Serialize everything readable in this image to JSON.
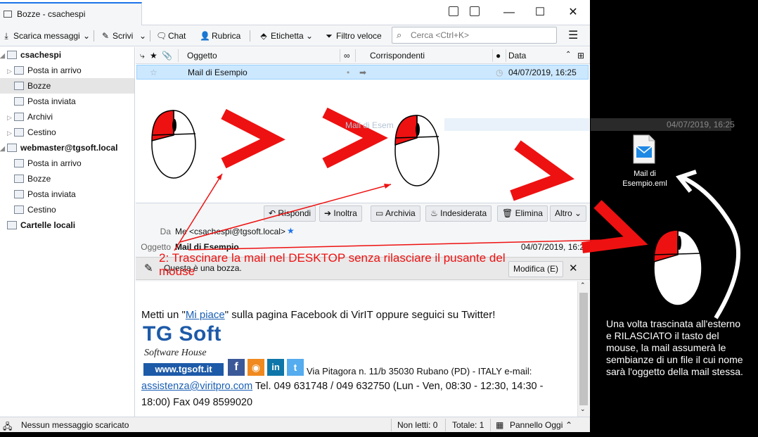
{
  "window": {
    "tab_title": "Bozze - csachespi",
    "minimize": "—",
    "maximize": "☐",
    "close": "✕"
  },
  "toolbar": {
    "get_messages": "Scarica messaggi",
    "write": "Scrivi",
    "chat": "Chat",
    "address_book": "Rubrica",
    "tag": "Etichetta",
    "quick_filter": "Filtro veloce",
    "search_placeholder": "Cerca <Ctrl+K>",
    "menu": "☰"
  },
  "folders": [
    {
      "label": "csachespi",
      "type": "account"
    },
    {
      "label": "Posta in arrivo",
      "type": "folder"
    },
    {
      "label": "Bozze",
      "type": "folder",
      "selected": true
    },
    {
      "label": "Posta inviata",
      "type": "folder"
    },
    {
      "label": "Archivi",
      "type": "folder"
    },
    {
      "label": "Cestino",
      "type": "folder"
    },
    {
      "label": "webmaster@tgsoft.local",
      "type": "account"
    },
    {
      "label": "Posta in arrivo",
      "type": "folder"
    },
    {
      "label": "Bozze",
      "type": "folder"
    },
    {
      "label": "Posta inviata",
      "type": "folder"
    },
    {
      "label": "Cestino",
      "type": "folder"
    },
    {
      "label": "Cartelle locali",
      "type": "account"
    }
  ],
  "list": {
    "col_subject": "Oggetto",
    "col_correspondents": "Corrispondenti",
    "col_date": "Data",
    "row": {
      "subject": "Mail di Esempio",
      "date": "04/07/2019, 16:25"
    }
  },
  "header": {
    "reply": "Rispondi",
    "forward": "Inoltra",
    "archive": "Archivia",
    "junk": "Indesiderata",
    "delete": "Elimina",
    "more": "Altro",
    "from_label": "Da",
    "from_value": "Me <csachespi@tgsoft.local>",
    "subject_label": "Oggetto",
    "subject_value": "Mail di Esempio",
    "date_value": "04/07/2019, 16:25",
    "draft_notice": "Questa è una bozza.",
    "edit_button": "Modifica (E)"
  },
  "body": {
    "line1_pre": "Metti un \"",
    "line1_link": "Mi piace",
    "line1_post": "\" sulla pagina Facebook di VirIT oppure seguici su Twitter!",
    "logo_top": "TG Soft",
    "logo_mid": "Software House",
    "logo_url": "www.tgsoft.it",
    "address": "Via Pitagora n. 11/b 35030 Rubano (PD) - ITALY e-mail:",
    "email_link": "assistenza@viritpro.com",
    "phones": " Tel. 049 631748 / 049 632750 (Lun - Ven, 08:30 - 12:30, 14:30 -",
    "phones2": "18:00) Fax 049 8599020"
  },
  "status": {
    "left": "Nessun messaggio scaricato",
    "unread": "Non letti: 0",
    "total": "Totale: 1",
    "today_pane": "Pannello Oggi"
  },
  "overlay": {
    "caption": "2: Trascinare la mail nel DESKTOP senza rilasciare il pusante del mouse",
    "note": "Una volta trascinata all'esterno e RILASCIATO il tasto del mouse, la mail assumerà le sembianze di un file il cui nome sarà l'oggetto della mail stessa.",
    "desktop_file": "Mail di Esempio.eml",
    "ghost_subject": "Mail di Esem",
    "ghost_date": "04/07/2019, 16:25"
  },
  "colors": {
    "accent": "#1a73e8",
    "selection": "#cce8ff",
    "arrow_red": "#ee1111"
  }
}
